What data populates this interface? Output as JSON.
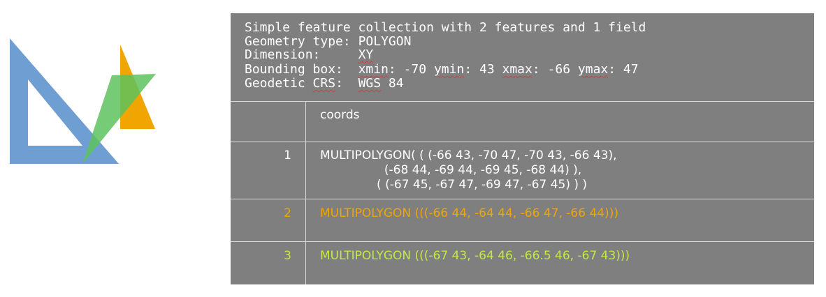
{
  "logo": {
    "colors": {
      "blue": "#6f9fd2",
      "orange": "#f0a500",
      "green": "#5ec25e"
    }
  },
  "summary": {
    "line1": "Simple feature collection with 2 features and 1 field",
    "geom_label": "Geometry type: ",
    "geom_value": "POLYGON",
    "dim_label": "Dimension:     ",
    "dim_value": "XY",
    "bbox_label": "Bounding box:  ",
    "bbox_xmin": "xmin",
    "bbox_xmin_val": ": -70 ",
    "bbox_ymin": "ymin",
    "bbox_ymin_val": ": 43 ",
    "bbox_xmax": "xmax",
    "bbox_xmax_val": ": -66 ",
    "bbox_ymax": "ymax",
    "bbox_ymax_val": ": 47",
    "crs_label_a": "Geodetic ",
    "crs_label_b": "CRS",
    "crs_label_c": ":  ",
    "crs_value_a": "WGS",
    "crs_value_b": " 84"
  },
  "table": {
    "column_header": "coords",
    "rows": [
      {
        "index": "1",
        "color": "#ffffff",
        "lines": [
          "MULTIPOLYGON( ( (-66 43, -70 47, -70 43, -66 43),",
          "                 (-68 44, -69 44, -69 45, -68 44) ),",
          "               ( (-67 45, -67 47, -69 47, -67 45) ) )"
        ]
      },
      {
        "index": "2",
        "color": "#f0a500",
        "lines": [
          "MULTIPOLYGON (((-66 44, -64 44, -66 47, -66 44)))"
        ]
      },
      {
        "index": "3",
        "color": "#c4e84a",
        "lines": [
          "MULTIPOLYGON (((-67 43, -64 46, -66.5 46, -67 43)))"
        ]
      }
    ]
  }
}
